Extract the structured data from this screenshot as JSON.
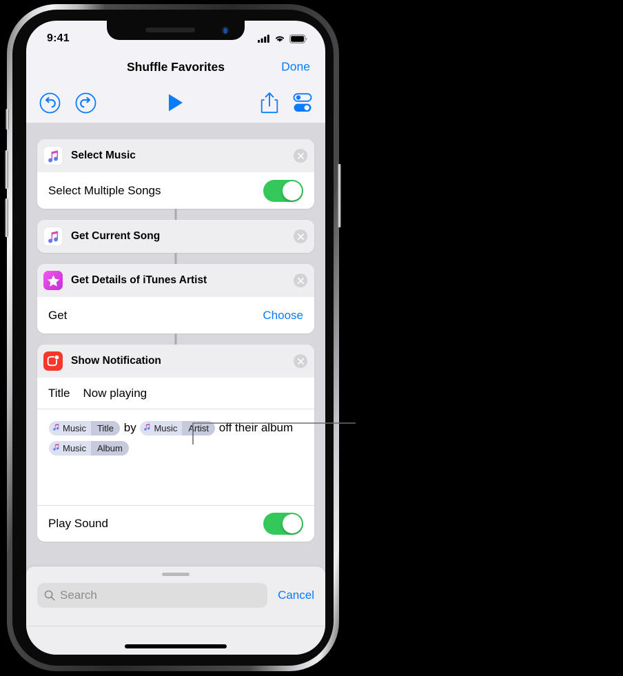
{
  "device": {
    "name": "iphone-x",
    "status_bar": {
      "time": "9:41",
      "icons": [
        "cellular-signal-icon",
        "wifi-icon",
        "battery-icon"
      ]
    },
    "home_indicator": true
  },
  "nav_bar": {
    "title": "Shuffle Favorites",
    "done_label": "Done"
  },
  "toolbar": {
    "buttons": [
      {
        "name": "undo-button",
        "icon": "undo-icon"
      },
      {
        "name": "redo-button",
        "icon": "redo-icon"
      },
      {
        "name": "play-button",
        "icon": "play-icon"
      },
      {
        "name": "share-button",
        "icon": "share-icon"
      },
      {
        "name": "settings-button",
        "icon": "toggles-icon"
      }
    ]
  },
  "colors": {
    "accent_blue": "#0a7cff",
    "toggle_green": "#34c759",
    "music_icon_bg": "#ffffff",
    "itunes_icon_bg": "#e84ce0",
    "notification_icon_bg": "#f8372c",
    "screen_bg": "#d7d7dc",
    "card_header_bg": "#eeeef1",
    "token_bg": "#dde1ef",
    "token_prop_bg": "#c5cadd"
  },
  "actions": [
    {
      "id": "select-music",
      "title": "Select Music",
      "icon": "music-app-icon",
      "close_icon": "close-circle-icon",
      "rows": [
        {
          "type": "toggle",
          "label": "Select Multiple Songs",
          "value": "on"
        }
      ]
    },
    {
      "id": "get-current-song",
      "title": "Get Current Song",
      "icon": "music-app-icon",
      "close_icon": "close-circle-icon",
      "rows": []
    },
    {
      "id": "get-details-of-itunes-artist",
      "title": "Get Details of iTunes Artist",
      "icon": "itunes-star-icon",
      "close_icon": "close-circle-icon",
      "rows": [
        {
          "type": "action",
          "label": "Get",
          "action_label": "Choose"
        }
      ]
    },
    {
      "id": "show-notification",
      "title": "Show Notification",
      "icon": "notification-app-icon",
      "close_icon": "close-circle-icon",
      "title_field": {
        "label": "Title",
        "value": "Now playing"
      },
      "body": {
        "segments": [
          {
            "type": "token",
            "app": "Music",
            "property": "Title",
            "icon": "music-note-icon"
          },
          {
            "type": "text",
            "text": " by "
          },
          {
            "type": "token",
            "app": "Music",
            "property": "Artist",
            "icon": "music-note-icon"
          },
          {
            "type": "text",
            "text": " off their album "
          },
          {
            "type": "token",
            "app": "Music",
            "property": "Album",
            "icon": "music-note-icon"
          }
        ]
      },
      "rows": [
        {
          "type": "toggle",
          "label": "Play Sound",
          "value": "on"
        }
      ]
    }
  ],
  "search_sheet": {
    "grabber": "sheet-grabber",
    "search_icon": "search-icon",
    "placeholder": "Search",
    "value": "",
    "cancel_label": "Cancel"
  },
  "callout": {
    "present": true,
    "target": "artist-token",
    "label": ""
  }
}
